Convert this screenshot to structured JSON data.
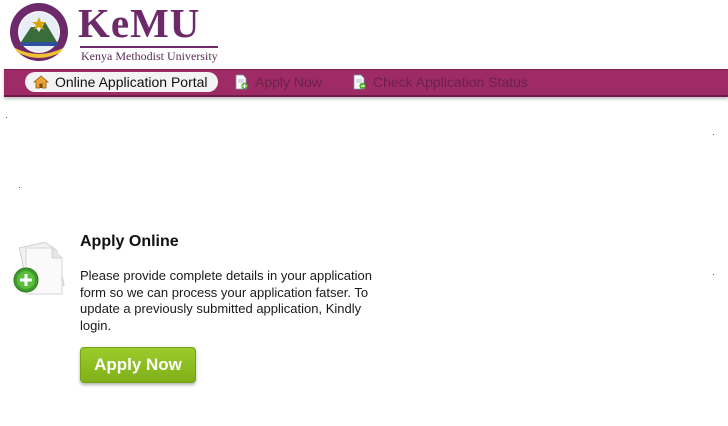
{
  "header": {
    "logo_text": "KeMU",
    "logo_subtitle": "Kenya Methodist University",
    "seal_icon": "university-seal-icon"
  },
  "nav": {
    "items": [
      {
        "label": "Online Application Portal",
        "icon": "home-icon",
        "active": true
      },
      {
        "label": "Apply Now",
        "icon": "document-add-icon",
        "active": false
      },
      {
        "label": "Check Application Status",
        "icon": "document-check-icon",
        "active": false
      }
    ]
  },
  "main": {
    "title": "Apply Online",
    "description": "Please provide complete details in your application form so we can process your application fatser. To update a previously submitted application, Kindly login.",
    "button_label": "Apply Now",
    "icon": "new-document-icon"
  },
  "colors": {
    "brand_purple": "#6d2a6b",
    "navbar": "#9e2a66",
    "button_green": "#8dbf22"
  }
}
